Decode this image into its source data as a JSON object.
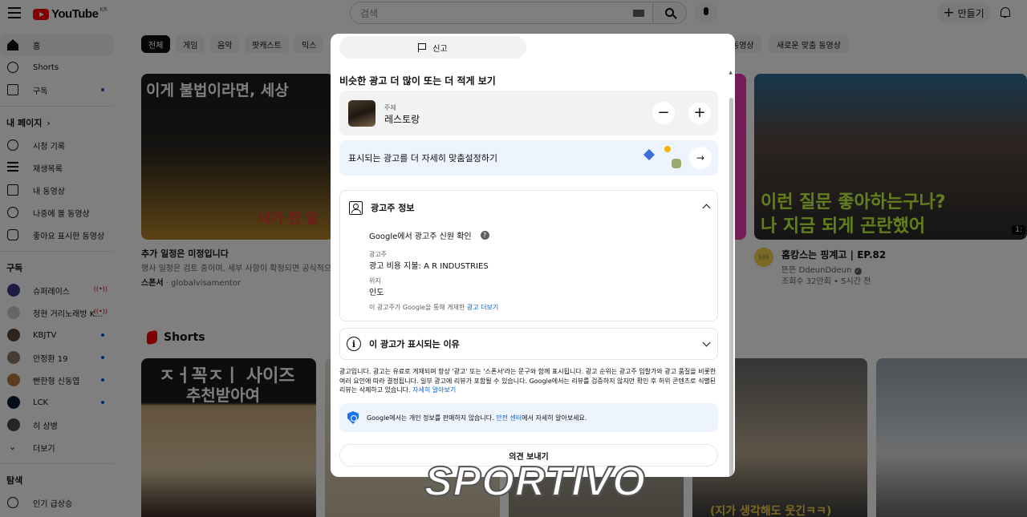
{
  "header": {
    "logo_text": "YouTube",
    "logo_region": "KR",
    "search_placeholder": "검색",
    "create_label": "만들기"
  },
  "sidebar": {
    "main": [
      {
        "label": "홈",
        "icon": "home-icon"
      },
      {
        "label": "Shorts",
        "icon": "shorts-icon"
      },
      {
        "label": "구독",
        "icon": "subscriptions-icon"
      }
    ],
    "my_page_heading": "내 페이지",
    "my_page": [
      {
        "label": "시청 기록",
        "icon": "history-icon"
      },
      {
        "label": "재생목록",
        "icon": "playlist-icon"
      },
      {
        "label": "내 동영상",
        "icon": "my-videos-icon"
      },
      {
        "label": "나중에 볼 동영상",
        "icon": "watch-later-icon"
      },
      {
        "label": "좋아요 표시한 동영상",
        "icon": "like-icon"
      }
    ],
    "subscriptions_heading": "구독",
    "subscriptions": [
      {
        "label": "슈퍼레이스",
        "status": "live",
        "live_glyph": "((•))"
      },
      {
        "label": "청현 거리노래방 K...",
        "status": "live",
        "live_glyph": "((•))"
      },
      {
        "label": "KBJTV",
        "status": "new"
      },
      {
        "label": "안정환 19",
        "status": "new"
      },
      {
        "label": "빤한형 신동엽",
        "status": "new"
      },
      {
        "label": "LCK",
        "status": "new"
      },
      {
        "label": "히 상병",
        "status": "none"
      },
      {
        "label": "더보기",
        "status": "none"
      }
    ],
    "explore_heading": "탐색",
    "explore": [
      {
        "label": "인기 급상승",
        "icon": "trending-icon"
      }
    ]
  },
  "chips": [
    "전체",
    "게임",
    "음악",
    "팟캐스트",
    "믹스",
    "동영상",
    "새로운 맞춤 동영상"
  ],
  "videos": [
    {
      "thumb_text_line1": "이게 불법이라면, 세상",
      "thumb_text_line2": "내가 한 일",
      "title": "추가 일정은 미정입니다",
      "desc": "행사 일정은 검토 중이며, 세부 사항이 확정되면 공식적으",
      "sponsor_label": "스폰서",
      "sponsor": "· globalvisamentor"
    },
    {
      "thumb_text_line1": "이런 질문 좋아하는구나?",
      "thumb_text_line2": "나 지금 되게 곤란했어",
      "title": "홈캉스는 핑계고 | EP.82",
      "channel": "뜬뜬 DdeunDdeun",
      "meta": "조회수 32만회 • 5시간 전",
      "channel_badge": "뜬뜬뜬",
      "duration": "1:"
    }
  ],
  "shorts": {
    "heading": "Shorts",
    "first_thumb_line1": "ㅈㅓ꼭ㅈㅣ 사이즈",
    "first_thumb_line2": "추천받아여",
    "last_thumb_caption": "(지가 생각해도 웃긴ㅋㅋ)"
  },
  "modal": {
    "report_label": "신고",
    "title": "비슷한 광고 더 많이 또는 더 적게 보기",
    "topic_label": "주제",
    "topic_value": "레스토랑",
    "minus": "−",
    "plus": "+",
    "customize_label": "표시되는 광고를 더 자세히 맞춤설정하기",
    "arrow": "→",
    "advertiser_heading": "광고주 정보",
    "verified_text": "Google에서 광고주 신원 확인",
    "help_glyph": "?",
    "advertiser_label": "광고주",
    "advertiser_value": "광고 비용 지불: A R INDUSTRIES",
    "location_label": "위치",
    "location_value": "인도",
    "note_text": "이 광고주가 Google을 통해 게재한 ",
    "note_link": "광고 더보기",
    "why_heading": "이 광고가 표시되는 이유",
    "info_glyph": "i",
    "disclaimer": "광고입니다. 광고는 유료로 게재되며 항상 '광고' 또는 '스폰서'라는 문구와 함께 표시됩니다. 광고 순위는 광고주 입찰가와 광고 품질을 비롯한 여러 요인에 따라 결정됩니다. 일부 광고에 리뷰가 포함될 수 있습니다. Google에서는 리뷰를 검증하지 않지만 확인 후 허위 콘텐츠로 식별된 리뷰는 삭제하고 있습니다. ",
    "disclaimer_link": "자세히 알아보기",
    "privacy_text_before": "Google에서는 개인 정보를 판매하지 않습니다. ",
    "privacy_link": "안전 센터",
    "privacy_text_after": "에서 자세히 알아보세요.",
    "feedback_label": "의견 보내기"
  },
  "watermark": "SPORTIVO"
}
